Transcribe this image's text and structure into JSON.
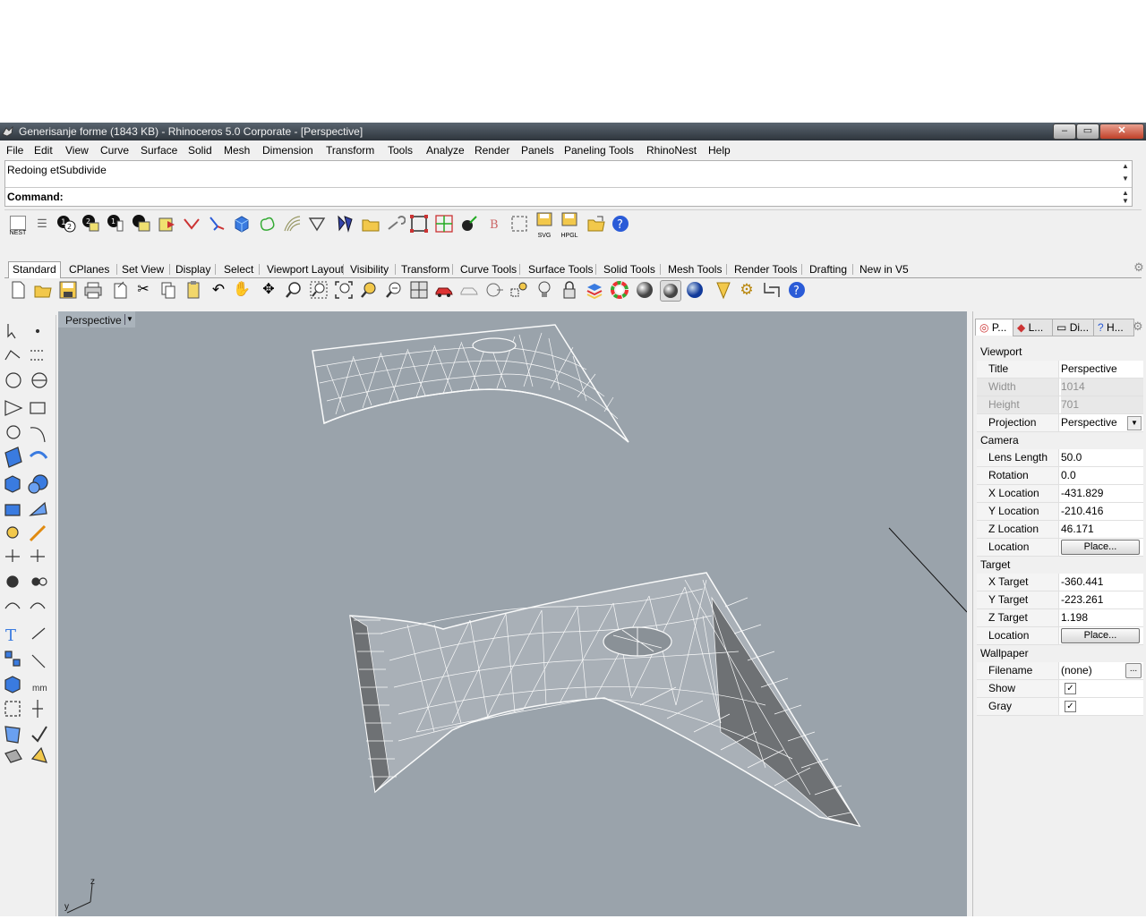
{
  "window": {
    "title": "Generisanje forme (1843 KB) - Rhinoceros  5.0 Corporate - [Perspective]",
    "min_label": "‒",
    "max_label": "▭",
    "close_label": "✕"
  },
  "menu": [
    "File",
    "Edit",
    "View",
    "Curve",
    "Surface",
    "Solid",
    "Mesh",
    "Dimension",
    "Transform",
    "Tools",
    "Analyze",
    "Render",
    "Panels",
    "Paneling Tools",
    "RhinoNest",
    "Help"
  ],
  "command": {
    "history": "Redoing etSubdivide",
    "label": "Command:",
    "value": ""
  },
  "toolbar1": {
    "nest_label": "NEST",
    "svg_label": "SVG",
    "hpgl_label": "HPGL"
  },
  "tabs": [
    "Standard",
    "CPlanes",
    "Set View",
    "Display",
    "Select",
    "Viewport Layout",
    "Visibility",
    "Transform",
    "Curve Tools",
    "Surface Tools",
    "Solid Tools",
    "Mesh Tools",
    "Render Tools",
    "Drafting",
    "New in V5"
  ],
  "viewport": {
    "name": "Perspective",
    "axis_z": "z",
    "axis_y": "y"
  },
  "panel": {
    "tabs": [
      "P...",
      "L...",
      "Di...",
      "H..."
    ],
    "sections": {
      "viewport": "Viewport",
      "camera": "Camera",
      "target": "Target",
      "wallpaper": "Wallpaper"
    },
    "viewport_rows": [
      {
        "key": "Title",
        "value": "Perspective"
      },
      {
        "key": "Width",
        "value": "1014"
      },
      {
        "key": "Height",
        "value": "701"
      },
      {
        "key": "Projection",
        "value": "Perspective"
      }
    ],
    "camera_rows": [
      {
        "key": "Lens Length",
        "value": "50.0"
      },
      {
        "key": "Rotation",
        "value": "0.0"
      },
      {
        "key": "X Location",
        "value": "-431.829"
      },
      {
        "key": "Y Location",
        "value": "-210.416"
      },
      {
        "key": "Z Location",
        "value": "46.171"
      },
      {
        "key": "Location",
        "value": "Place..."
      }
    ],
    "target_rows": [
      {
        "key": "X Target",
        "value": "-360.441"
      },
      {
        "key": "Y Target",
        "value": "-223.261"
      },
      {
        "key": "Z Target",
        "value": "1.198"
      },
      {
        "key": "Location",
        "value": "Place..."
      }
    ],
    "wallpaper_rows": [
      {
        "key": "Filename",
        "value": "(none)"
      },
      {
        "key": "Show",
        "value": "✓"
      },
      {
        "key": "Gray",
        "value": "✓"
      }
    ],
    "ellipsis": "..."
  },
  "colors": {
    "viewport_bg": "#9aa3ab",
    "wire": "#ffffff",
    "titlebar": "#3a424a"
  }
}
